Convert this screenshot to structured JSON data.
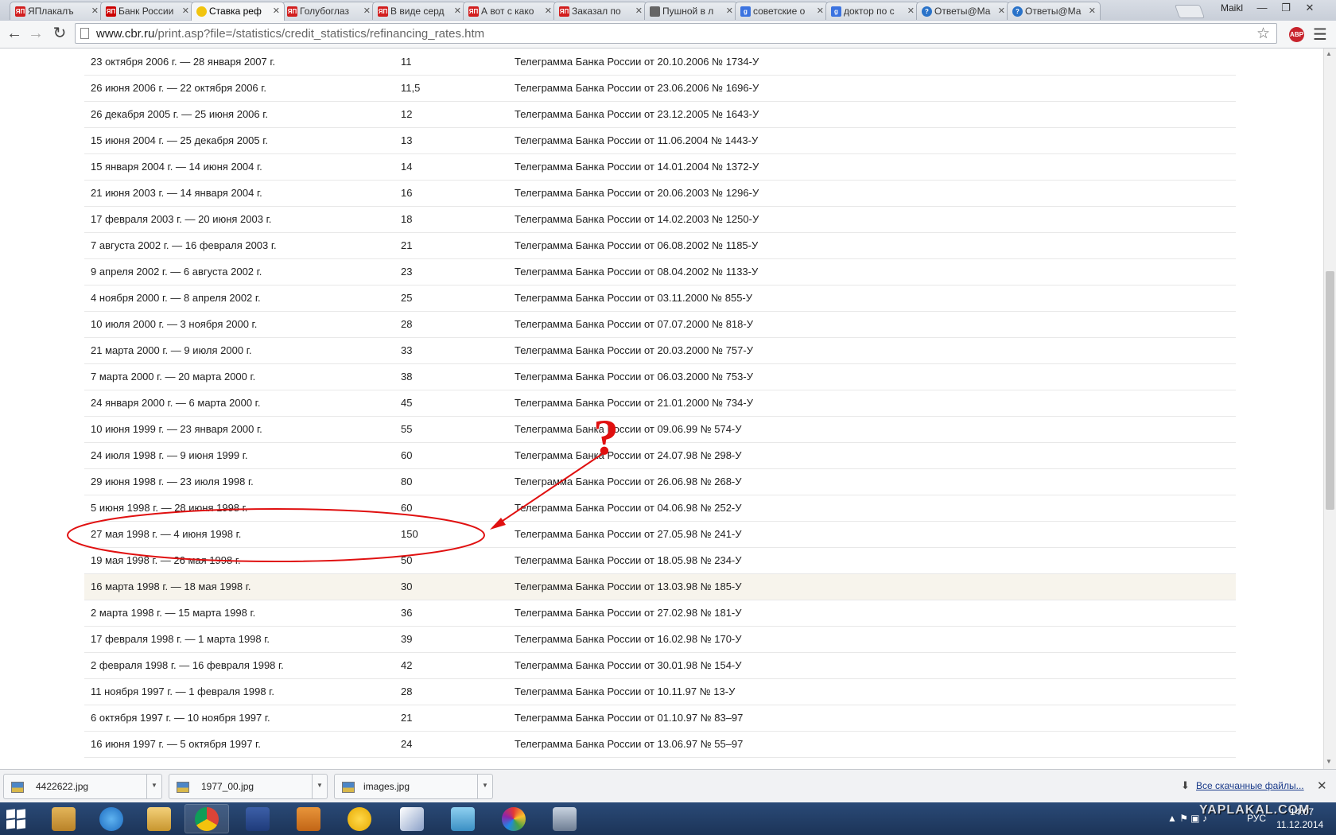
{
  "browser": {
    "tabs": [
      {
        "label": "ЯПлакалъ",
        "favicon": "yap"
      },
      {
        "label": "Банк России",
        "favicon": "bank"
      },
      {
        "label": "Ставка реф",
        "favicon": "smile",
        "active": true
      },
      {
        "label": "Голубоглаз",
        "favicon": "yap"
      },
      {
        "label": "В виде серд",
        "favicon": "yap"
      },
      {
        "label": "А вот с како",
        "favicon": "yap"
      },
      {
        "label": "Заказал по",
        "favicon": "yap"
      },
      {
        "label": "Пушной в л",
        "favicon": "sound"
      },
      {
        "label": "советские о",
        "favicon": "google"
      },
      {
        "label": "доктор по с",
        "favicon": "google"
      },
      {
        "label": "Ответы@Ма",
        "favicon": "answers"
      },
      {
        "label": "Ответы@Ма",
        "favicon": "answers"
      }
    ],
    "user_name": "Maikl",
    "url_host": "www.cbr.ru",
    "url_path": "/print.asp?file=/statistics/credit_statistics/refinancing_rates.htm",
    "abp_label": "ABP"
  },
  "table": {
    "rows": [
      {
        "period": "23 октября 2006 г. — 28 января 2007 г.",
        "rate": "11",
        "doc": "Телеграмма Банка России от 20.10.2006 № 1734-У"
      },
      {
        "period": "26 июня 2006 г. — 22 октября 2006 г.",
        "rate": "11,5",
        "doc": "Телеграмма Банка России от 23.06.2006 № 1696-У"
      },
      {
        "period": "26 декабря 2005 г. — 25 июня 2006 г.",
        "rate": "12",
        "doc": "Телеграмма Банка России от 23.12.2005 № 1643-У"
      },
      {
        "period": "15 июня 2004 г. — 25 декабря 2005 г.",
        "rate": "13",
        "doc": "Телеграмма Банка России от 11.06.2004 № 1443-У"
      },
      {
        "period": "15 января 2004 г. — 14 июня 2004 г.",
        "rate": "14",
        "doc": "Телеграмма Банка России от 14.01.2004 № 1372-У"
      },
      {
        "period": "21 июня 2003 г. — 14 января 2004 г.",
        "rate": "16",
        "doc": "Телеграмма Банка России от 20.06.2003 № 1296-У"
      },
      {
        "period": "17 февраля 2003 г. — 20 июня 2003 г.",
        "rate": "18",
        "doc": "Телеграмма Банка России от 14.02.2003 № 1250-У"
      },
      {
        "period": "7 августа 2002 г. — 16 февраля 2003 г.",
        "rate": "21",
        "doc": "Телеграмма Банка России от 06.08.2002 № 1185-У"
      },
      {
        "period": "9 апреля 2002 г. — 6 августа 2002 г.",
        "rate": "23",
        "doc": "Телеграмма Банка России от 08.04.2002 № 1133-У"
      },
      {
        "period": "4 ноября 2000 г. — 8 апреля 2002 г.",
        "rate": "25",
        "doc": "Телеграмма Банка России от 03.11.2000 № 855-У"
      },
      {
        "period": "10 июля 2000 г. — 3 ноября 2000 г.",
        "rate": "28",
        "doc": "Телеграмма Банка России от 07.07.2000 № 818-У"
      },
      {
        "period": "21 марта 2000 г. — 9 июля 2000 г.",
        "rate": "33",
        "doc": "Телеграмма Банка России от 20.03.2000 № 757-У"
      },
      {
        "period": "7 марта 2000 г. — 20 марта 2000 г.",
        "rate": "38",
        "doc": "Телеграмма Банка России от 06.03.2000 № 753-У"
      },
      {
        "period": "24 января 2000 г. — 6 марта 2000 г.",
        "rate": "45",
        "doc": "Телеграмма Банка России от 21.01.2000 № 734-У"
      },
      {
        "period": "10 июня 1999 г. — 23 января 2000 г.",
        "rate": "55",
        "doc": "Телеграмма Банка России от 09.06.99 № 574-У"
      },
      {
        "period": "24 июля 1998 г. — 9 июня 1999 г.",
        "rate": "60",
        "doc": "Телеграмма Банка России от 24.07.98 № 298-У"
      },
      {
        "period": "29 июня 1998 г. — 23 июля 1998 г.",
        "rate": "80",
        "doc": "Телеграмма Банка России от 26.06.98 № 268-У"
      },
      {
        "period": "5 июня 1998 г. — 28 июня 1998 г.",
        "rate": "60",
        "doc": "Телеграмма Банка России от 04.06.98 № 252-У"
      },
      {
        "period": "27 мая 1998 г. — 4 июня 1998 г.",
        "rate": "150",
        "doc": "Телеграмма Банка России от 27.05.98 № 241-У"
      },
      {
        "period": "19 мая 1998 г. — 26 мая 1998 г.",
        "rate": "50",
        "doc": "Телеграмма Банка России от 18.05.98 № 234-У"
      },
      {
        "period": "16 марта 1998 г. — 18 мая 1998 г.",
        "rate": "30",
        "doc": "Телеграмма Банка России от 13.03.98 № 185-У",
        "highlight": true
      },
      {
        "period": "2 марта 1998 г. — 15 марта 1998 г.",
        "rate": "36",
        "doc": "Телеграмма Банка России от 27.02.98 № 181-У"
      },
      {
        "period": "17 февраля 1998 г. — 1 марта 1998 г.",
        "rate": "39",
        "doc": "Телеграмма Банка России от 16.02.98 № 170-У"
      },
      {
        "period": "2 февраля 1998 г. — 16 февраля 1998 г.",
        "rate": "42",
        "doc": "Телеграмма Банка России от 30.01.98 № 154-У"
      },
      {
        "period": "11 ноября 1997 г. — 1 февраля 1998 г.",
        "rate": "28",
        "doc": "Телеграмма Банка России от 10.11.97 № 13-У"
      },
      {
        "period": "6 октября 1997 г. — 10 ноября 1997 г.",
        "rate": "21",
        "doc": "Телеграмма Банка России от 01.10.97 № 83–97"
      },
      {
        "period": "16 июня 1997 г. — 5 октября 1997 г.",
        "rate": "24",
        "doc": "Телеграмма Банка России от 13.06.97 № 55–97"
      }
    ]
  },
  "annotation": {
    "mark": "?",
    "color": "#e01010"
  },
  "downloads": {
    "items": [
      {
        "name": "4422622.jpg"
      },
      {
        "name": "1977_00.jpg"
      },
      {
        "name": "images.jpg"
      }
    ],
    "all_link": "Все скачанные файлы..."
  },
  "taskbar": {
    "watermark": "YAPLAKAL.COM",
    "lang": "РУС",
    "time": "14:07",
    "date": "11.12.2014"
  }
}
